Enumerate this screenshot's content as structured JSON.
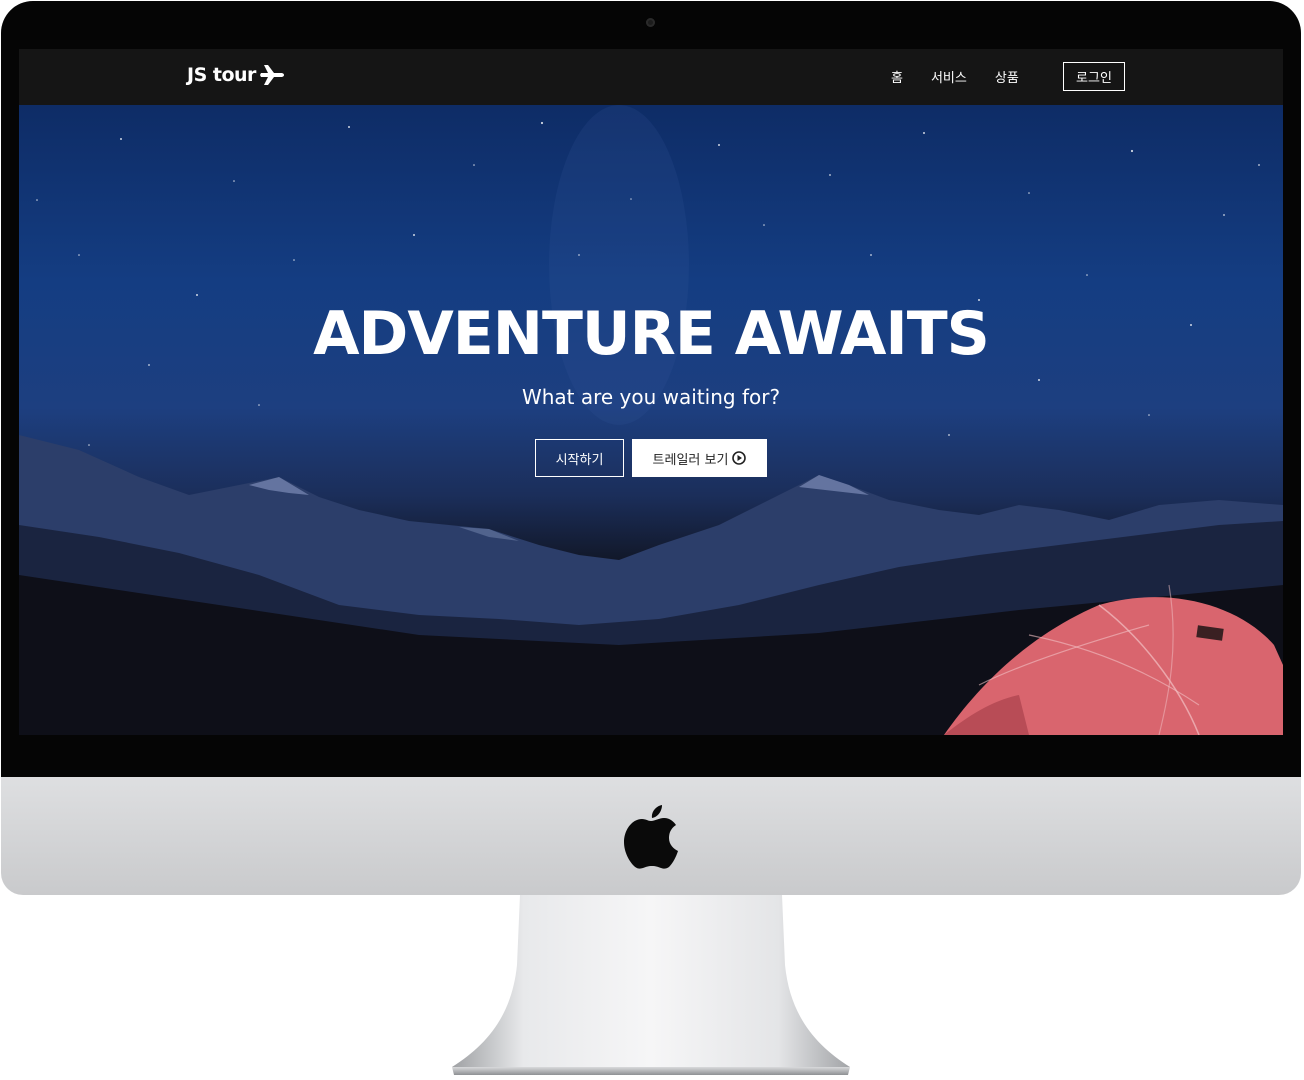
{
  "navbar": {
    "brand": "JS tour",
    "brand_icon": "airplane-icon",
    "links": [
      {
        "label": "홈"
      },
      {
        "label": "서비스"
      },
      {
        "label": "상품"
      }
    ],
    "login_label": "로그인"
  },
  "hero": {
    "title": "ADVENTURE AWAITS",
    "subtitle": "What are you waiting for?",
    "start_label": "시작하기",
    "trailer_label": "트레일러 보기",
    "trailer_icon": "play-circle-icon"
  },
  "device": {
    "logo_icon": "apple-logo-icon"
  },
  "colors": {
    "navbar_bg": "#151515",
    "sky_top": "#0e2c66",
    "sky_mid": "#1d3f80",
    "tent": "#d9656e"
  }
}
